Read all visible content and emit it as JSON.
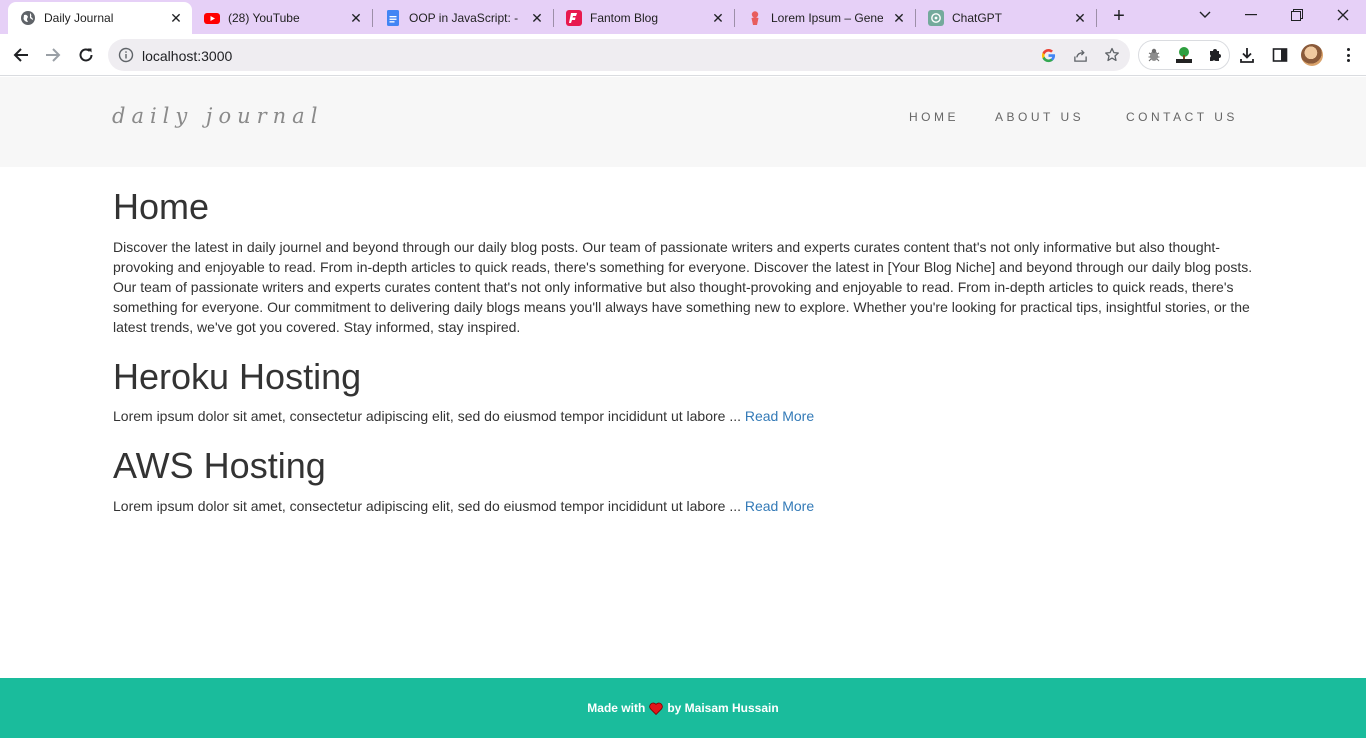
{
  "browser": {
    "tabs": [
      {
        "title": "Daily Journal",
        "icon": "globe-icon",
        "active": true
      },
      {
        "title": "(28) YouTube",
        "icon": "youtube-icon",
        "active": false
      },
      {
        "title": "OOP in JavaScript: - G",
        "icon": "google-docs-icon",
        "active": false
      },
      {
        "title": "Fantom Blog",
        "icon": "fantom-icon",
        "active": false
      },
      {
        "title": "Lorem Ipsum – Genera",
        "icon": "lorem-ipsum-icon",
        "active": false
      },
      {
        "title": "ChatGPT",
        "icon": "chatgpt-icon",
        "active": false
      }
    ],
    "url": "localhost:3000",
    "colors": {
      "tabbar": "#e6d0f7",
      "omnibox": "#efedf1"
    }
  },
  "site": {
    "brand": "daily journal",
    "nav": {
      "home": "HOME",
      "about": "ABOUT US",
      "contact": "CONTACT US"
    }
  },
  "home": {
    "title": "Home",
    "content": "Discover the latest in daily journel and beyond through our daily blog posts. Our team of passionate writers and experts curates content that's not only informative but also thought-provoking and enjoyable to read. From in-depth articles to quick reads, there's something for everyone. Discover the latest in [Your Blog Niche] and beyond through our daily blog posts. Our team of passionate writers and experts curates content that's not only informative but also thought-provoking and enjoyable to read. From in-depth articles to quick reads, there's something for everyone. Our commitment to delivering daily blogs means you'll always have something new to explore. Whether you're looking for practical tips, insightful stories, or the latest trends, we've got you covered. Stay informed, stay inspired."
  },
  "posts": [
    {
      "title": "Heroku Hosting",
      "excerpt": "Lorem ipsum dolor sit amet, consectetur adipiscing elit, sed do eiusmod tempor incididunt ut labore ...",
      "link": "Read More"
    },
    {
      "title": "AWS Hosting",
      "excerpt": "Lorem ipsum dolor sit amet, consectetur adipiscing elit, sed do eiusmod tempor incididunt ut labore ...",
      "link": "Read More"
    }
  ],
  "footer": {
    "prefix": "Made with",
    "suffix": "by Maisam Hussain",
    "accent": "#1abc9c",
    "heart_color": "#e3141b"
  }
}
